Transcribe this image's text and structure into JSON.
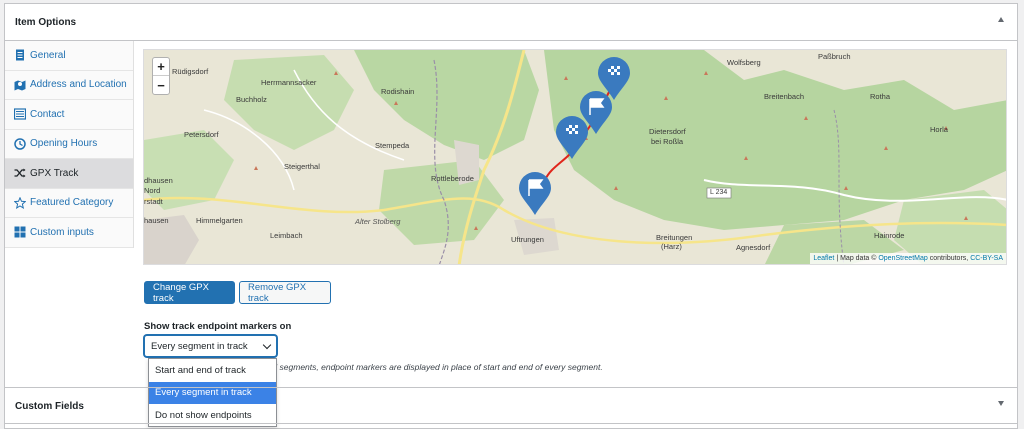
{
  "item_options": {
    "title": "Item Options"
  },
  "tabs": [
    {
      "label": "General",
      "icon": "document-icon"
    },
    {
      "label": "Address and Location",
      "icon": "map-icon"
    },
    {
      "label": "Contact",
      "icon": "list-icon"
    },
    {
      "label": "Opening Hours",
      "icon": "clock-icon"
    },
    {
      "label": "GPX Track",
      "icon": "shuffle-icon"
    },
    {
      "label": "Featured Category",
      "icon": "star-icon"
    },
    {
      "label": "Custom inputs",
      "icon": "grid-icon"
    }
  ],
  "map": {
    "zoom_in": "+",
    "zoom_out": "−",
    "places": [
      {
        "name": "Paßbruch"
      },
      {
        "name": "Wolfsberg"
      },
      {
        "name": "Rüdigsdorf"
      },
      {
        "name": "Herrmannsacker"
      },
      {
        "name": "Buchholz"
      },
      {
        "name": "Rodishain"
      },
      {
        "name": "Breitenbach"
      },
      {
        "name": "Rotha"
      },
      {
        "name": "Petersdorf"
      },
      {
        "name": "Dietersdorf"
      },
      {
        "name": "bei Roßla"
      },
      {
        "name": "Horla"
      },
      {
        "name": "Stempeda"
      },
      {
        "name": "Steigerthal"
      },
      {
        "name": "Rottleberode"
      },
      {
        "name": "dhausen"
      },
      {
        "name": "Nord"
      },
      {
        "name": "rstadt"
      },
      {
        "name": "L 234"
      },
      {
        "name": "Himmelgarten"
      },
      {
        "name": "Alter Stolberg"
      },
      {
        "name": "hausen"
      },
      {
        "name": "Leimbach"
      },
      {
        "name": "Uftrungen"
      },
      {
        "name": "Breitungen"
      },
      {
        "name": "(Harz)"
      },
      {
        "name": "Agnesdorf"
      },
      {
        "name": "Hainrode"
      }
    ],
    "attribution": {
      "leaflet": "Leaflet",
      "sep": " | Map data © ",
      "osm": "OpenStreetMap",
      "contrib": " contributors, ",
      "license": "CC-BY-SA"
    }
  },
  "buttons": {
    "change": "Change GPX track",
    "remove": "Remove GPX track"
  },
  "endpoint": {
    "label": "Show track endpoint markers on",
    "selected": "Every segment in track",
    "description": "eral segments, endpoint markers are displayed in place of start and end of every segment.",
    "options": [
      "Start and end of track",
      "Every segment in track",
      "Do not show endpoints"
    ],
    "selected_index": 1
  },
  "custom_fields": {
    "title": "Custom Fields"
  },
  "colors": {
    "accent": "#2271b1",
    "marker": "#3a7abf",
    "track": "#e0251b",
    "highlight": "#3b82e6"
  }
}
